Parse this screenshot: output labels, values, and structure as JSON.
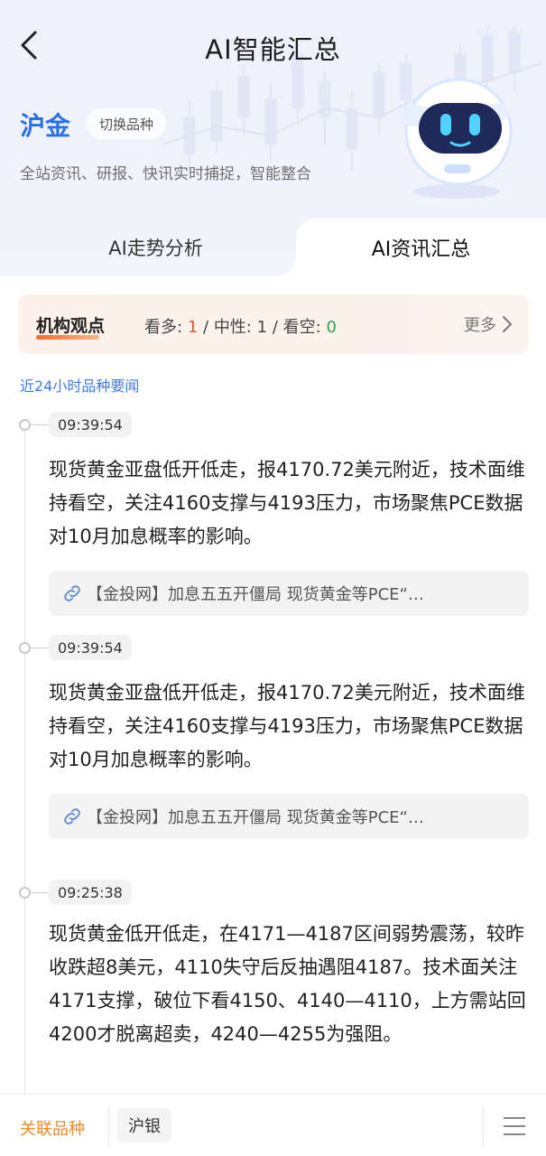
{
  "header": {
    "title": "AI智能汇总",
    "variety": "沪金",
    "switch_label": "切换品种",
    "description": "全站资讯、研报、快讯实时捕捉，智能整合"
  },
  "tabs": [
    {
      "label": "AI走势分析",
      "active": false
    },
    {
      "label": "AI资讯汇总",
      "active": true
    }
  ],
  "opinion": {
    "title": "机构观点",
    "bull_label": "看多:",
    "bull_value": "1",
    "neutral_label": "中性:",
    "neutral_value": "1",
    "bear_label": "看空:",
    "bear_value": "0",
    "separator": "/",
    "more_label": "更多"
  },
  "section_label": "近24小时品种要闻",
  "news": [
    {
      "time": "09:39:54",
      "text": "现货黄金亚盘低开低走，报4170.72美元附近，技术面维持看空，关注4160支撑与4193压力，市场聚焦PCE数据对10月加息概率的影响。",
      "source": "【金投网】加息五五开僵局 现货黄金等PCE“…"
    },
    {
      "time": "09:39:54",
      "text": "现货黄金亚盘低开低走，报4170.72美元附近，技术面维持看空，关注4160支撑与4193压力，市场聚焦PCE数据对10月加息概率的影响。",
      "source": "【金投网】加息五五开僵局 现货黄金等PCE“…"
    },
    {
      "time": "09:25:38",
      "text": "现货黄金低开低走，在4171—4187区间弱势震荡，较昨收跌超8美元，4110失守后反抽遇阻4187。技术面关注4171支撑，破位下看4150、4140—4110，上方需站回4200才脱离超卖，4240—4255为强阻。",
      "source": ""
    }
  ],
  "bottom": {
    "related_label": "关联品种",
    "related_variety": "沪银"
  },
  "colors": {
    "accent_blue": "#2d6fe6",
    "bull_red": "#e9532c",
    "bear_green": "#2aa653",
    "related_orange": "#ef8a2b"
  }
}
